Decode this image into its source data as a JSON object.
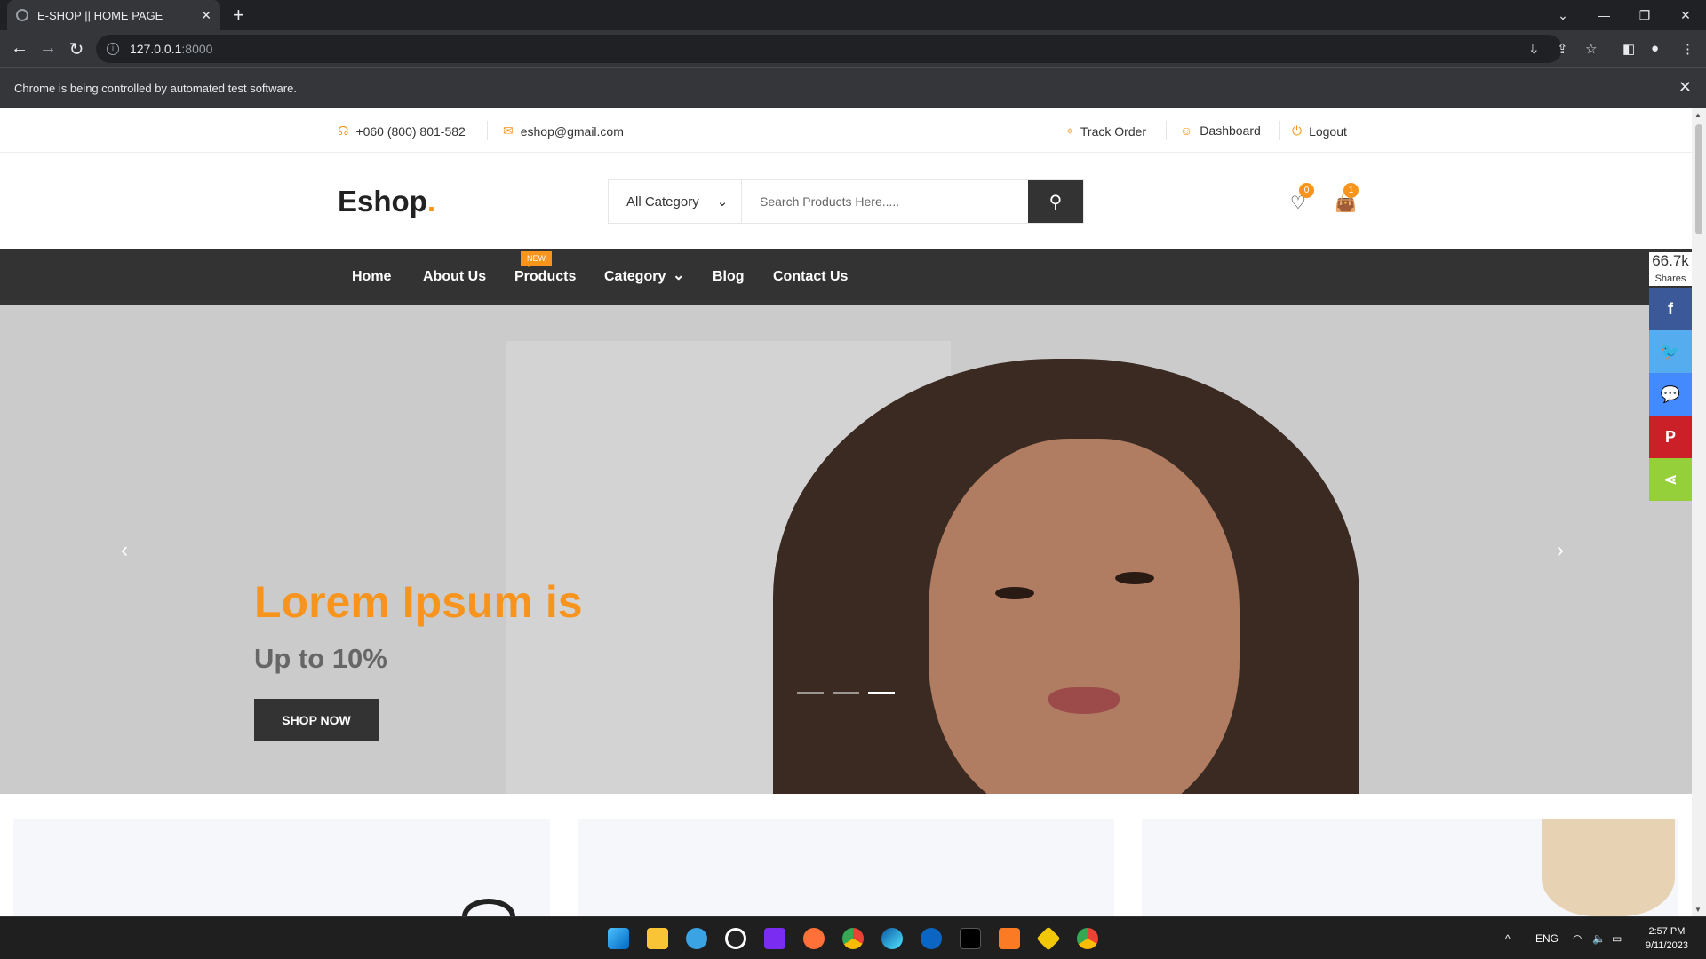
{
  "browser": {
    "tab_title": "E-SHOP || HOME PAGE",
    "tab_close": "✕",
    "new_tab": "+",
    "url_host": "127.0.0.1",
    "url_port": ":8000",
    "automation_notice": "Chrome is being controlled by automated test software.",
    "notice_close": "✕"
  },
  "topbar": {
    "phone": "+060 (800) 801-582",
    "email": "eshop@gmail.com",
    "track_order": "Track Order",
    "dashboard": "Dashboard",
    "logout": "Logout"
  },
  "header": {
    "logo": "Eshop",
    "logo_dot": ".",
    "category_select": "All Category",
    "search_placeholder": "Search Products Here.....",
    "wishlist_count": "0",
    "cart_count": "1"
  },
  "nav": {
    "items": [
      "Home",
      "About Us",
      "Products",
      "Category",
      "Blog",
      "Contact Us"
    ],
    "new_badge": "NEW",
    "category_caret": "⌄"
  },
  "hero": {
    "title": "Lorem Ipsum is",
    "subtitle": "Up to 10%",
    "button": "SHOP NOW",
    "prev": "‹",
    "next": "›",
    "slide_count": 3,
    "active_slide": 3
  },
  "share": {
    "count": "66.7k",
    "label": "Shares",
    "icons": [
      "facebook-icon",
      "twitter-icon",
      "messenger-icon",
      "pinterest-icon",
      "share-icon"
    ],
    "colors": [
      "#3b5998",
      "#55acee",
      "#448aff",
      "#cb2027",
      "#95d03a"
    ]
  },
  "taskbar": {
    "language": "ENG",
    "time": "2:57 PM",
    "date": "9/11/2023"
  },
  "colors": {
    "accent": "#f7941d",
    "dark": "#333333"
  }
}
